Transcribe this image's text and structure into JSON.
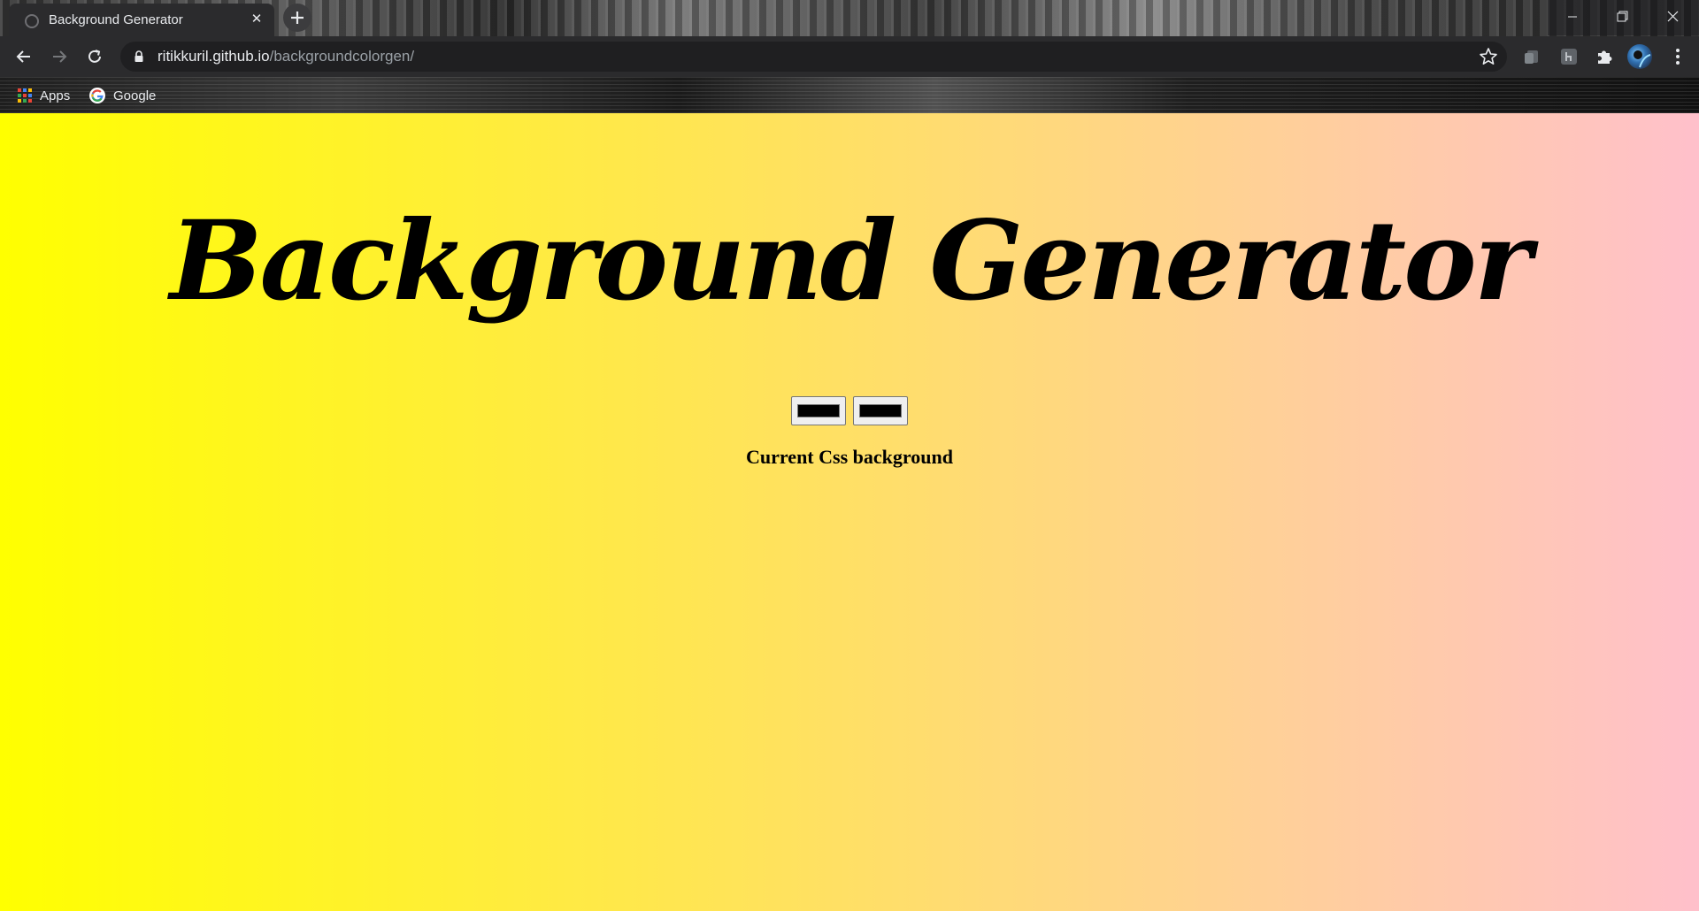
{
  "tab": {
    "title": "Background Generator",
    "close_glyph": "✕"
  },
  "window_controls": {
    "minimize": "—",
    "restore": "❐",
    "close": "✕"
  },
  "toolbar": {
    "url_host": "ritikkuril.github.io",
    "url_path": "/backgroundcolorgen/"
  },
  "bookmarks": {
    "items": [
      {
        "label": "Apps",
        "icon": "apps-grid-icon"
      },
      {
        "label": "Google",
        "icon": "google-icon"
      }
    ]
  },
  "page": {
    "title": "Background Generator",
    "color1": "#000000",
    "color2": "#000000",
    "current_css_label": "Current Css background",
    "gradient_start": "#ffff00",
    "gradient_end": "#ffc0cb"
  }
}
